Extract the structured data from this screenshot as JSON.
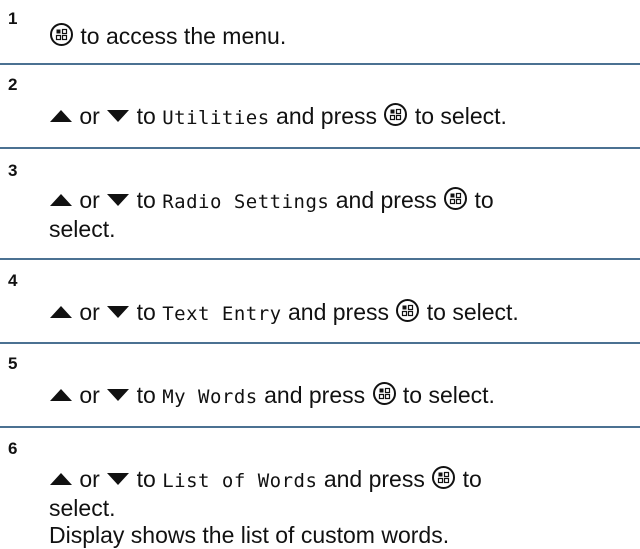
{
  "steps": [
    {
      "num": "1",
      "lead": "to access the menu."
    },
    {
      "num": "2",
      "or": "or",
      "to": "to",
      "target": "Utilities",
      "press": "and press",
      "tail": "to select."
    },
    {
      "num": "3",
      "or": "or",
      "to": "to",
      "target": "Radio Settings",
      "press": "and press",
      "tail": "to",
      "tail2": "select."
    },
    {
      "num": "4",
      "or": "or",
      "to": "to",
      "target": "Text Entry",
      "press": "and press",
      "tail": "to select."
    },
    {
      "num": "5",
      "or": "or",
      "to": "to",
      "target": "My Words",
      "press": "and press",
      "tail": "to select."
    },
    {
      "num": "6",
      "or": "or",
      "to": "to",
      "target": "List of Words",
      "press": "and press",
      "tail": "to",
      "tail2": "select.",
      "note": "Display shows the list of custom words."
    }
  ],
  "colors": {
    "divider": "#4b7192",
    "text": "#111111"
  },
  "icons": {
    "menu_button": "menu-ok-button-icon",
    "up": "up-arrow-icon",
    "down": "down-arrow-icon"
  }
}
